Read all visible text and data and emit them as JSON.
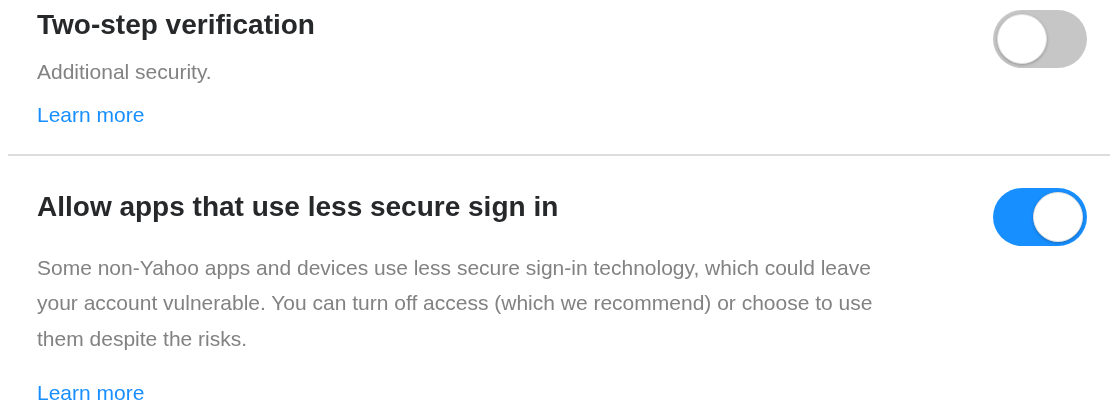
{
  "settings": [
    {
      "title": "Two-step verification",
      "description": "Additional security.",
      "link": "Learn more",
      "on": false
    },
    {
      "title": "Allow apps that use less secure sign in",
      "description": "Some non-Yahoo apps and devices use less secure sign-in technology, which could leave your account vulnerable. You can turn off access (which we recommend) or choose to use them despite the risks.",
      "link": "Learn more",
      "on": true
    }
  ]
}
